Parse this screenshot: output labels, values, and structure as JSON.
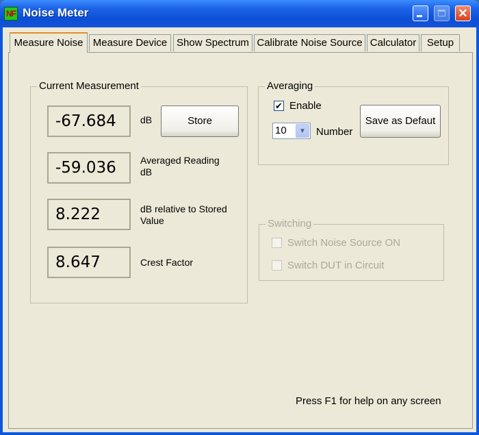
{
  "window": {
    "title": "Noise Meter",
    "icon_text": "NF"
  },
  "tabs": [
    {
      "label": "Measure Noise",
      "active": true
    },
    {
      "label": "Measure Device",
      "active": false
    },
    {
      "label": "Show Spectrum",
      "active": false
    },
    {
      "label": "Calibrate Noise Source",
      "active": false
    },
    {
      "label": "Calculator",
      "active": false
    },
    {
      "label": "Setup",
      "active": false
    }
  ],
  "current_measurement": {
    "title": "Current Measurement",
    "readings": [
      {
        "value": "-67.684",
        "label": "dB"
      },
      {
        "value": "-59.036",
        "label": "Averaged Reading dB"
      },
      {
        "value": "8.222",
        "label": "dB relative to Stored Value"
      },
      {
        "value": "8.647",
        "label": "Crest Factor"
      }
    ],
    "store_label": "Store"
  },
  "averaging": {
    "title": "Averaging",
    "enable_label": "Enable",
    "enable_checked": true,
    "number_value": "10",
    "number_label": "Number",
    "save_default_label": "Save as Defaut"
  },
  "switching": {
    "title": "Switching",
    "options": [
      {
        "label": "Switch Noise Source ON",
        "checked": false
      },
      {
        "label": "Switch DUT in Circuit",
        "checked": false
      }
    ]
  },
  "help_text": "Press F1 for help on any screen",
  "icons": {
    "app": "nf-app-icon",
    "minimize": "minimize-icon",
    "maximize": "maximize-icon",
    "close": "close-icon",
    "dropdown": "chevron-down-icon",
    "check": "checkmark-icon"
  }
}
